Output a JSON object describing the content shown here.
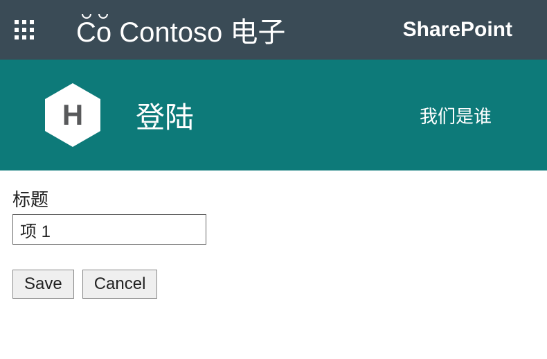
{
  "suite": {
    "brand": "Co Contoso 电子",
    "product": "SharePoint"
  },
  "site": {
    "logo_letter": "H",
    "title": "登陆",
    "nav": [
      "我们是谁"
    ]
  },
  "form": {
    "title_label": "标题",
    "title_value": "项 1",
    "save_label": "Save",
    "cancel_label": "Cancel"
  }
}
